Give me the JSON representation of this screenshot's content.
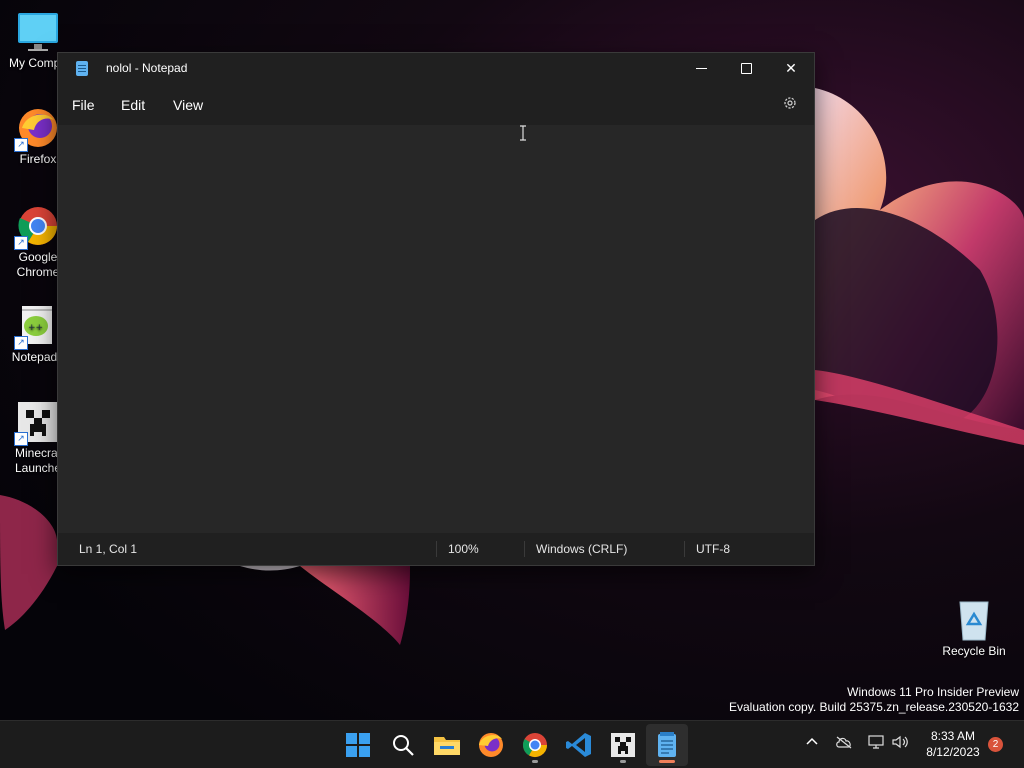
{
  "desktop": {
    "icons": [
      {
        "label": "My Compu"
      },
      {
        "label": "Firefox"
      },
      {
        "label": "Google Chrome"
      },
      {
        "label": "Notepad+"
      },
      {
        "label": "Minecraf Launche"
      },
      {
        "label": "Recycle Bin"
      }
    ],
    "watermark": {
      "line1": "Windows 11 Pro Insider Preview",
      "line2": "Evaluation copy. Build 25375.zn_release.230520-1632"
    }
  },
  "window": {
    "title": "nolol - Notepad",
    "menu": {
      "file": "File",
      "edit": "Edit",
      "view": "View"
    },
    "editor_text": "",
    "status": {
      "position": "Ln 1, Col 1",
      "zoom": "100%",
      "line_endings": "Windows (CRLF)",
      "encoding": "UTF-8"
    }
  },
  "taskbar": {
    "apps": [
      "start",
      "search",
      "file-explorer",
      "firefox",
      "chrome",
      "vscode",
      "minecraft-launcher",
      "notepad"
    ],
    "active_app": "notepad",
    "clock": {
      "time": "8:33 AM",
      "date": "8/12/2023"
    },
    "notification_count": "2"
  },
  "colors": {
    "window_bg": "#272727",
    "titlebar_bg": "#202020",
    "taskbar_bg": "#1c1c1c",
    "active_indicator": "#f07f5a"
  }
}
